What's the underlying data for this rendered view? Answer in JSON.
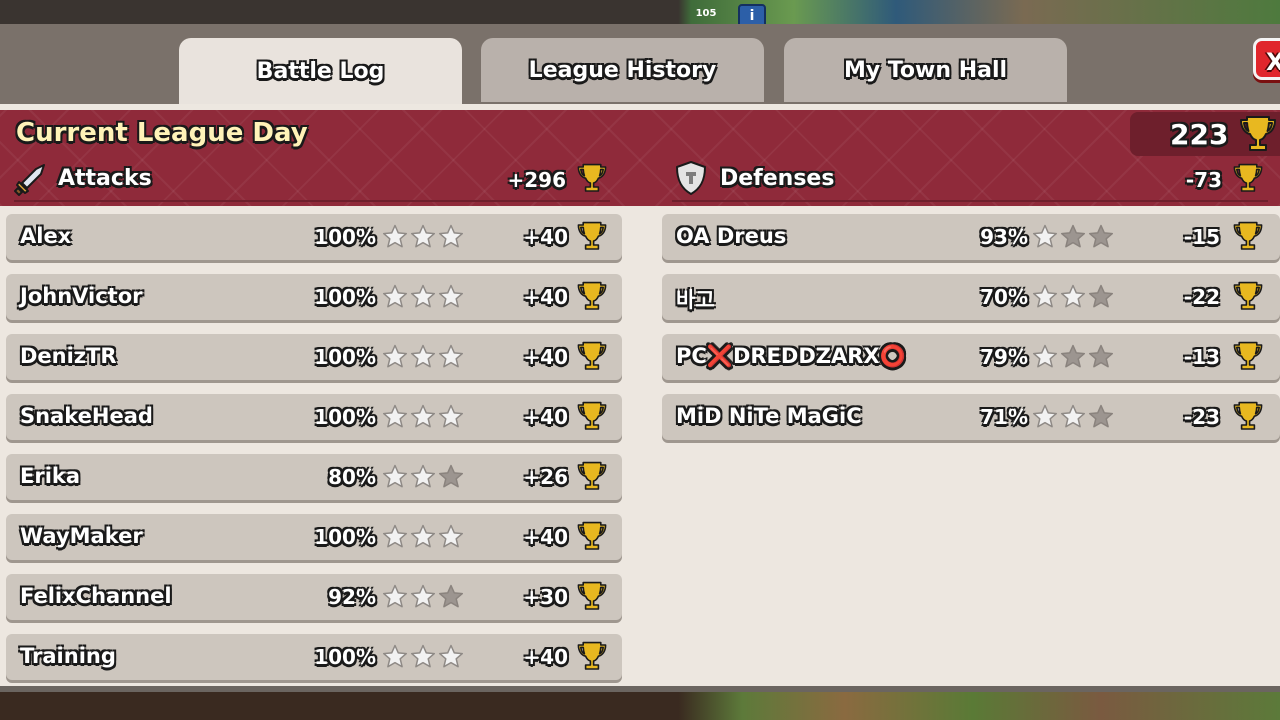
{
  "hud": {
    "level": "105",
    "info_icon": "i"
  },
  "tabs": [
    {
      "label": "Battle Log",
      "active": true
    },
    {
      "label": "League History",
      "active": false
    },
    {
      "label": "My Town Hall",
      "active": false
    }
  ],
  "close_label": "X",
  "header": {
    "title": "Current League Day",
    "total_trophies": "223"
  },
  "attacks": {
    "label": "Attacks",
    "total": "+296",
    "icon": "sword-icon",
    "rows": [
      {
        "name": "Alex",
        "percent": "100%",
        "stars": 3,
        "trophies": "+40"
      },
      {
        "name": "JohnVictor",
        "percent": "100%",
        "stars": 3,
        "trophies": "+40"
      },
      {
        "name": "DenizTR",
        "percent": "100%",
        "stars": 3,
        "trophies": "+40"
      },
      {
        "name": "SnakeHead",
        "percent": "100%",
        "stars": 3,
        "trophies": "+40"
      },
      {
        "name": "Erika",
        "percent": "80%",
        "stars": 2,
        "trophies": "+26"
      },
      {
        "name": "WayMaker",
        "percent": "100%",
        "stars": 3,
        "trophies": "+40"
      },
      {
        "name": "FelixChannel",
        "percent": "92%",
        "stars": 2,
        "trophies": "+30"
      },
      {
        "name": "Training",
        "percent": "100%",
        "stars": 3,
        "trophies": "+40"
      }
    ]
  },
  "defenses": {
    "label": "Defenses",
    "total": "-73",
    "icon": "shield-icon",
    "rows": [
      {
        "name": "OA Dreus",
        "percent": "93%",
        "stars": 1,
        "trophies": "-15"
      },
      {
        "name": "바고",
        "percent": "70%",
        "stars": 2,
        "trophies": "-22"
      },
      {
        "name": "PC❌DREDDZARX⭕",
        "percent": "79%",
        "stars": 1,
        "trophies": "-13"
      },
      {
        "name": "MiD NiTe MaGiC",
        "percent": "71%",
        "stars": 2,
        "trophies": "-23"
      }
    ]
  },
  "colors": {
    "banner": "#8f2a3a",
    "panel": "#ede7e0",
    "row": "#cdc6be",
    "trophy": "#e8b820",
    "close": "#e0262c"
  }
}
